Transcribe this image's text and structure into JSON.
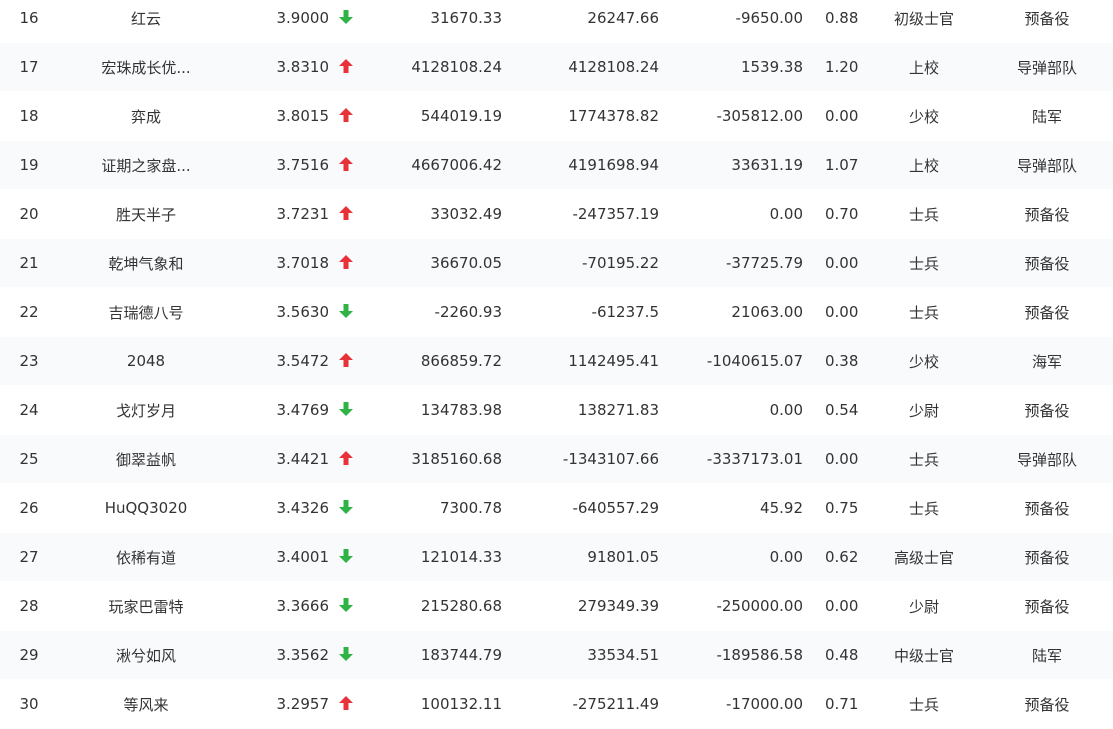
{
  "colors": {
    "up": "#e8323a",
    "down": "#2fb344",
    "text": "#333333",
    "stripe": "#f9fafc"
  },
  "rows": [
    {
      "rank": "16",
      "name": "红云",
      "score": "3.9000",
      "trend": "down",
      "v1": "31670.33",
      "v2": "26247.66",
      "v3": "-9650.00",
      "ratio": "0.88",
      "rank_title": "初级士官",
      "unit": "预备役"
    },
    {
      "rank": "17",
      "name": "宏珠成长优...",
      "score": "3.8310",
      "trend": "up",
      "v1": "4128108.24",
      "v2": "4128108.24",
      "v3": "1539.38",
      "ratio": "1.20",
      "rank_title": "上校",
      "unit": "导弹部队"
    },
    {
      "rank": "18",
      "name": "弈成",
      "score": "3.8015",
      "trend": "up",
      "v1": "544019.19",
      "v2": "1774378.82",
      "v3": "-305812.00",
      "ratio": "0.00",
      "rank_title": "少校",
      "unit": "陆军"
    },
    {
      "rank": "19",
      "name": "证期之家盘...",
      "score": "3.7516",
      "trend": "up",
      "v1": "4667006.42",
      "v2": "4191698.94",
      "v3": "33631.19",
      "ratio": "1.07",
      "rank_title": "上校",
      "unit": "导弹部队"
    },
    {
      "rank": "20",
      "name": "胜天半子",
      "score": "3.7231",
      "trend": "up",
      "v1": "33032.49",
      "v2": "-247357.19",
      "v3": "0.00",
      "ratio": "0.70",
      "rank_title": "士兵",
      "unit": "预备役"
    },
    {
      "rank": "21",
      "name": "乾坤气象和",
      "score": "3.7018",
      "trend": "up",
      "v1": "36670.05",
      "v2": "-70195.22",
      "v3": "-37725.79",
      "ratio": "0.00",
      "rank_title": "士兵",
      "unit": "预备役"
    },
    {
      "rank": "22",
      "name": "吉瑞德八号",
      "score": "3.5630",
      "trend": "down",
      "v1": "-2260.93",
      "v2": "-61237.5",
      "v3": "21063.00",
      "ratio": "0.00",
      "rank_title": "士兵",
      "unit": "预备役"
    },
    {
      "rank": "23",
      "name": "2048",
      "score": "3.5472",
      "trend": "up",
      "v1": "866859.72",
      "v2": "1142495.41",
      "v3": "-1040615.07",
      "ratio": "0.38",
      "rank_title": "少校",
      "unit": "海军"
    },
    {
      "rank": "24",
      "name": "戈灯岁月",
      "score": "3.4769",
      "trend": "down",
      "v1": "134783.98",
      "v2": "138271.83",
      "v3": "0.00",
      "ratio": "0.54",
      "rank_title": "少尉",
      "unit": "预备役"
    },
    {
      "rank": "25",
      "name": "御翠益帆",
      "score": "3.4421",
      "trend": "up",
      "v1": "3185160.68",
      "v2": "-1343107.66",
      "v3": "-3337173.01",
      "ratio": "0.00",
      "rank_title": "士兵",
      "unit": "导弹部队"
    },
    {
      "rank": "26",
      "name": "HuQQ3020",
      "score": "3.4326",
      "trend": "down",
      "v1": "7300.78",
      "v2": "-640557.29",
      "v3": "45.92",
      "ratio": "0.75",
      "rank_title": "士兵",
      "unit": "预备役"
    },
    {
      "rank": "27",
      "name": "依稀有道",
      "score": "3.4001",
      "trend": "down",
      "v1": "121014.33",
      "v2": "91801.05",
      "v3": "0.00",
      "ratio": "0.62",
      "rank_title": "高级士官",
      "unit": "预备役"
    },
    {
      "rank": "28",
      "name": "玩家巴雷特",
      "score": "3.3666",
      "trend": "down",
      "v1": "215280.68",
      "v2": "279349.39",
      "v3": "-250000.00",
      "ratio": "0.00",
      "rank_title": "少尉",
      "unit": "预备役"
    },
    {
      "rank": "29",
      "name": "湫兮如风",
      "score": "3.3562",
      "trend": "down",
      "v1": "183744.79",
      "v2": "33534.51",
      "v3": "-189586.58",
      "ratio": "0.48",
      "rank_title": "中级士官",
      "unit": "陆军"
    },
    {
      "rank": "30",
      "name": "等风来",
      "score": "3.2957",
      "trend": "up",
      "v1": "100132.11",
      "v2": "-275211.49",
      "v3": "-17000.00",
      "ratio": "0.71",
      "rank_title": "士兵",
      "unit": "预备役"
    }
  ]
}
